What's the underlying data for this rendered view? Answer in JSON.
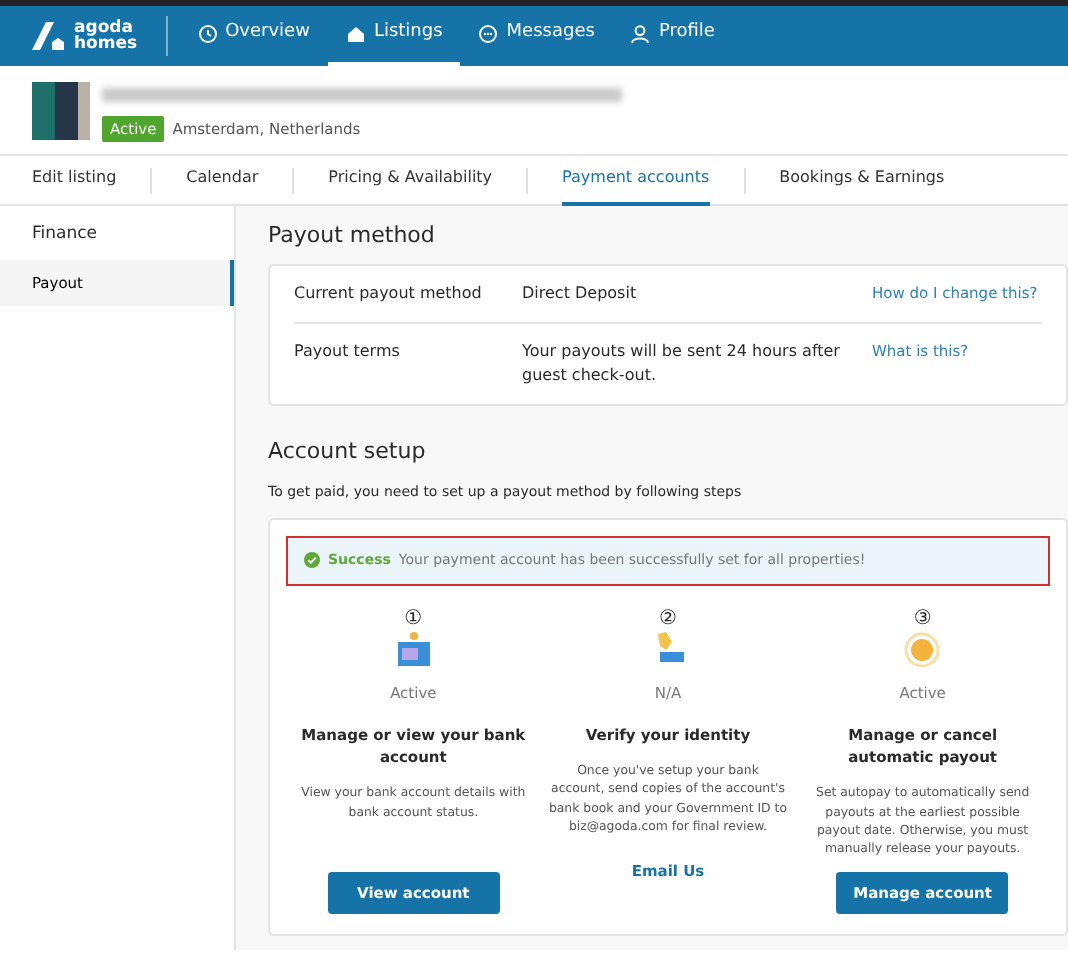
{
  "brand": {
    "lines": [
      "agoda",
      "homes"
    ]
  },
  "nav": [
    {
      "label": "Overview",
      "selected": false
    },
    {
      "label": "Listings",
      "selected": true
    },
    {
      "label": "Messages",
      "selected": false
    },
    {
      "label": "Profile",
      "selected": false
    }
  ],
  "listing": {
    "status": "Active",
    "location": "Amsterdam, Netherlands"
  },
  "tabs": [
    {
      "label": "Edit listing",
      "selected": false
    },
    {
      "label": "Calendar",
      "selected": false
    },
    {
      "label": "Pricing & Availability",
      "selected": false
    },
    {
      "label": "Payment accounts",
      "selected": true
    },
    {
      "label": "Bookings & Earnings",
      "selected": false
    }
  ],
  "sidebar": {
    "heading": "Finance",
    "items": [
      {
        "label": "Payout",
        "selected": true
      }
    ]
  },
  "payout_method": {
    "title": "Payout method",
    "rows": [
      {
        "label": "Current payout method",
        "value": "Direct Deposit",
        "link": "How do I change this?"
      },
      {
        "label": "Payout terms",
        "value": "Your payouts will be sent 24 hours after guest check-out.",
        "link": "What is this?"
      }
    ]
  },
  "account_setup": {
    "title": "Account setup",
    "intro": "To get paid, you need to set up a payout method by following steps",
    "alert": {
      "title": "Success",
      "message": "Your payment account has been successfully set for all properties!"
    },
    "steps": [
      {
        "number": "①",
        "status": "Active",
        "title": "Manage or view your bank account",
        "description": "View your bank account details with bank account status.",
        "action": {
          "kind": "button",
          "label": "View account"
        }
      },
      {
        "number": "②",
        "status": "N/A",
        "title": "Verify your identity",
        "description": "Once you've setup your bank account, send copies of the account's bank book and your Government ID to biz@agoda.com for final review.",
        "action": {
          "kind": "link",
          "label": "Email Us"
        }
      },
      {
        "number": "③",
        "status": "Active",
        "title": "Manage or cancel automatic payout",
        "description": "Set autopay to automatically send payouts at the earliest possible payout date. Otherwise, you must manually release your payouts.",
        "action": {
          "kind": "button",
          "label": "Manage account"
        }
      }
    ]
  }
}
